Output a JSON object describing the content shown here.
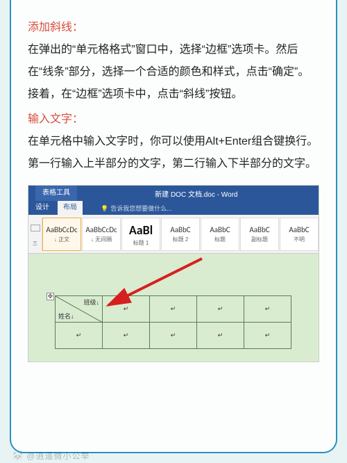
{
  "sections": [
    {
      "heading": "添加斜线：",
      "body": "在弹出的“单元格格式”窗口中，选择“边框”选项卡。然后在“线条”部分，选择一个合适的颜色和样式，点击“确定”。接着，在“边框”选项卡中，点击“斜线”按钮。"
    },
    {
      "heading": "输入文字：",
      "body": "在单元格中输入文字时，你可以使用Alt+Enter组合键换行。第一行输入上半部分的文字，第二行输入下半部分的文字。"
    }
  ],
  "word": {
    "context_tab": "表格工具",
    "title": "新建 DOC 文档.doc - Word",
    "tabs": {
      "design": "设计",
      "layout": "布局"
    },
    "hint": "告诉我您想要做什么...",
    "styles": [
      {
        "sample": "AaBbCcDc",
        "label": "↓ 正文"
      },
      {
        "sample": "AaBbCcDc",
        "label": "↓ 无间隔"
      },
      {
        "sample": "AaBl",
        "label": "标题 1"
      },
      {
        "sample": "AaBbC",
        "label": "标题 2"
      },
      {
        "sample": "AaBbC",
        "label": "标题"
      },
      {
        "sample": "AaBbC",
        "label": "副标题"
      },
      {
        "sample": "AaBbC",
        "label": "不明"
      }
    ],
    "cell": {
      "top": "班级↓",
      "bottom": "姓名↓"
    }
  },
  "watermark": "🐼 @逍遥微小公举"
}
